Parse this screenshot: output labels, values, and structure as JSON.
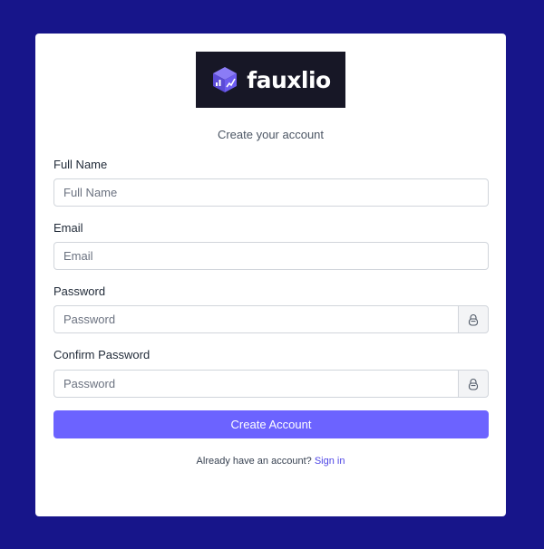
{
  "brand": {
    "name": "fauxlio",
    "logo_icon": "cube-chart-logo-icon",
    "colors": {
      "logo_bg": "#171726",
      "accent": "#6c63ff",
      "page_bg": "#17158a",
      "link": "#4f46e5"
    }
  },
  "form": {
    "subtitle": "Create your account",
    "full_name": {
      "label": "Full Name",
      "placeholder": "Full Name",
      "value": ""
    },
    "email": {
      "label": "Email",
      "placeholder": "Email",
      "value": ""
    },
    "password": {
      "label": "Password",
      "placeholder": "Password",
      "value": "",
      "toggle_icon": "lock-icon"
    },
    "confirm_password": {
      "label": "Confirm Password",
      "placeholder": "Password",
      "value": "",
      "toggle_icon": "lock-icon"
    },
    "submit_label": "Create Account"
  },
  "footer": {
    "prompt": "Already have an account?",
    "signin_label": "Sign in"
  }
}
